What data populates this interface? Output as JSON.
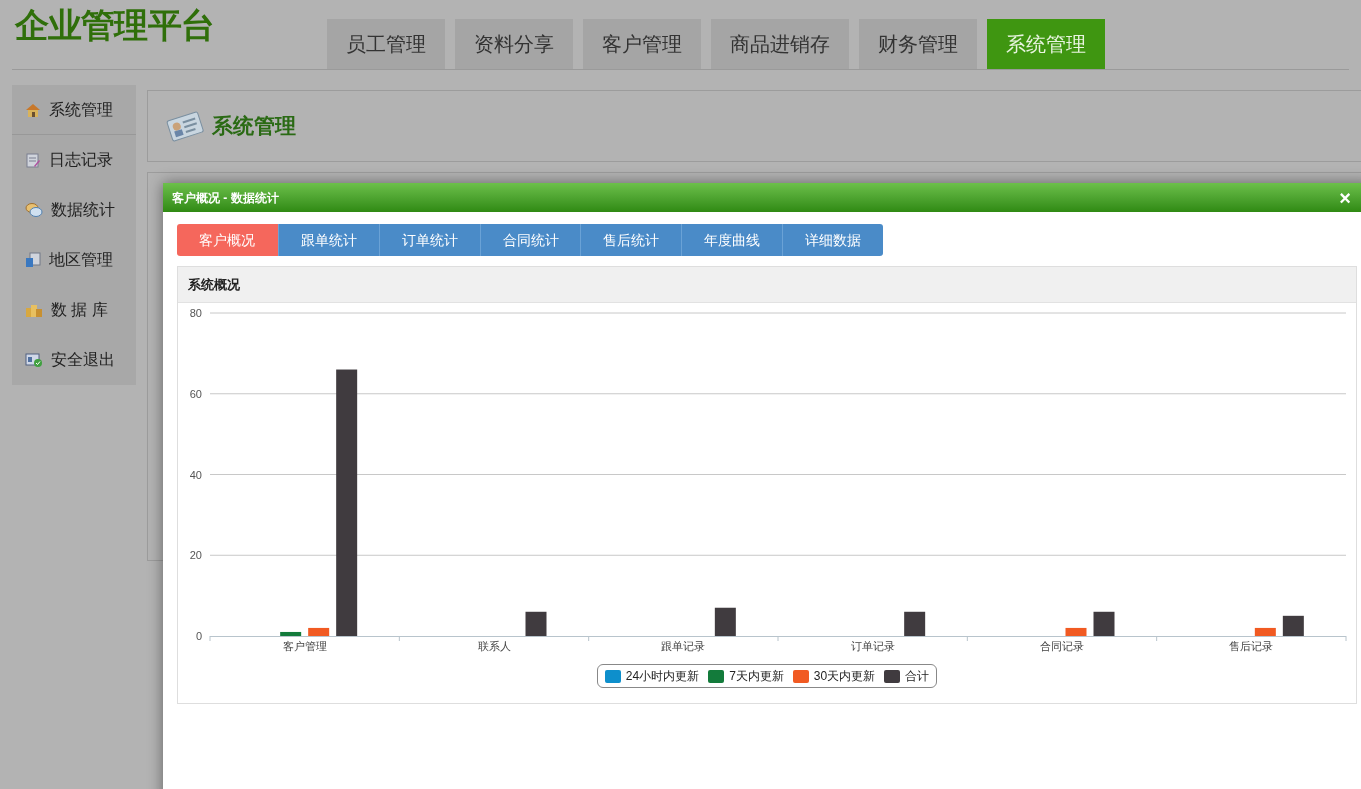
{
  "app": {
    "logo": "企业管理平台"
  },
  "nav_tabs": [
    {
      "label": "员工管理",
      "selected": false
    },
    {
      "label": "资料分享",
      "selected": false
    },
    {
      "label": "客户管理",
      "selected": false
    },
    {
      "label": "商品进销存",
      "selected": false
    },
    {
      "label": "财务管理",
      "selected": false
    },
    {
      "label": "系统管理",
      "selected": true
    }
  ],
  "sidebar": {
    "items": [
      {
        "label": "系统管理",
        "selected": true
      },
      {
        "label": "日志记录",
        "selected": false
      },
      {
        "label": "数据统计",
        "selected": false
      },
      {
        "label": "地区管理",
        "selected": false
      },
      {
        "label": "数 据 库",
        "selected": false
      },
      {
        "label": "安全退出",
        "selected": false
      }
    ]
  },
  "page_header": {
    "title": "系统管理"
  },
  "dialog": {
    "title": "客户概况 - 数据统计",
    "close": "×",
    "tabs": [
      {
        "label": "客户概况",
        "selected": true
      },
      {
        "label": "跟单统计",
        "selected": false
      },
      {
        "label": "订单统计",
        "selected": false
      },
      {
        "label": "合同统计",
        "selected": false
      },
      {
        "label": "售后统计",
        "selected": false
      },
      {
        "label": "年度曲线",
        "selected": false
      },
      {
        "label": "详细数据",
        "selected": false
      }
    ],
    "panel": {
      "title": "系统概况",
      "chart_data": {
        "type": "bar",
        "categories": [
          "客户管理",
          "联系人",
          "跟单记录",
          "订单记录",
          "合同记录",
          "售后记录"
        ],
        "series": [
          {
            "name": "24小时内更新",
            "color": "#0e8fcc",
            "values": [
              0,
              0,
              0,
              0,
              0,
              0
            ]
          },
          {
            "name": "7天内更新",
            "color": "#137b3b",
            "values": [
              1,
              0,
              0,
              0,
              0,
              0
            ]
          },
          {
            "name": "30天内更新",
            "color": "#f15a22",
            "values": [
              2,
              0,
              0,
              0,
              2,
              2
            ]
          },
          {
            "name": "合计",
            "color": "#403b3f",
            "values": [
              66,
              6,
              7,
              6,
              6,
              5
            ]
          }
        ],
        "ylim": [
          0,
          80
        ],
        "yticks": [
          0,
          20,
          40,
          60,
          80
        ],
        "grid": true,
        "legend": true
      }
    }
  }
}
